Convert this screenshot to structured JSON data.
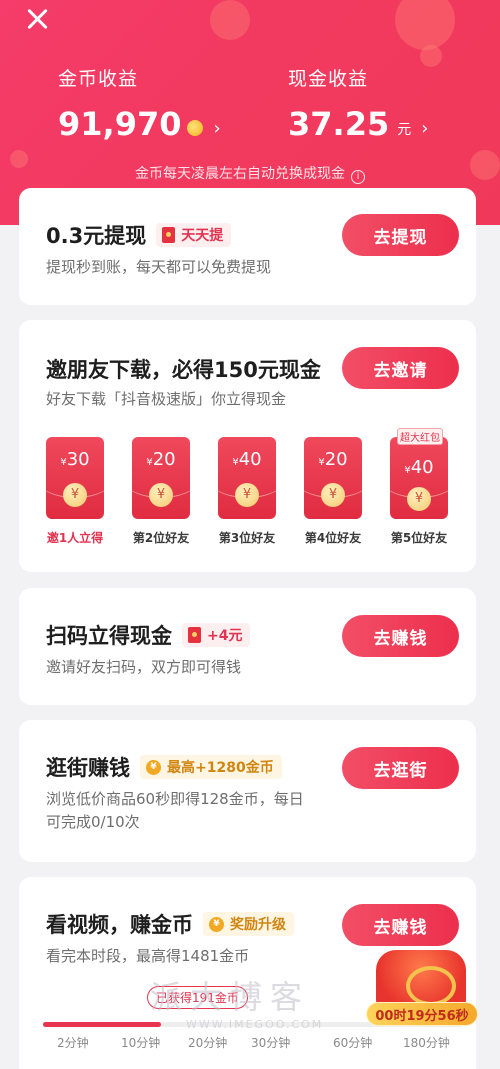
{
  "header": {
    "coin_earnings_label": "金币收益",
    "coin_earnings_value": "91,970",
    "cash_earnings_label": "现金收益",
    "cash_earnings_value": "37.25",
    "cash_unit": "元",
    "chevron": "›",
    "note": "金币每天凌晨左右自动兑换成现金",
    "accent_color": "#f23b61"
  },
  "withdraw_card": {
    "title": "0.3元提现",
    "tag": "天天提",
    "subtitle": "提现秒到账，每天都可以免费提现",
    "button": "去提现"
  },
  "invite_card": {
    "title": "邀朋友下载，必得150元现金",
    "subtitle": "好友下载「抖音极速版」你立得现金",
    "button": "去邀请",
    "packets": [
      {
        "amount": "30",
        "currency": "¥",
        "coin": "¥",
        "label": "邀1人立得",
        "badge": ""
      },
      {
        "amount": "20",
        "currency": "¥",
        "coin": "¥",
        "label": "第2位好友",
        "badge": ""
      },
      {
        "amount": "40",
        "currency": "¥",
        "coin": "¥",
        "label": "第3位好友",
        "badge": ""
      },
      {
        "amount": "20",
        "currency": "¥",
        "coin": "¥",
        "label": "第4位好友",
        "badge": ""
      },
      {
        "amount": "40",
        "currency": "¥",
        "coin": "¥",
        "label": "第5位好友",
        "badge": "超大红包"
      }
    ]
  },
  "scan_card": {
    "title": "扫码立得现金",
    "tag": "+4元",
    "subtitle": "邀请好友扫码，双方即可得钱",
    "button": "去赚钱"
  },
  "shop_card": {
    "title": "逛街赚钱",
    "tag": "最高+1280金币",
    "subtitle_line1": "浏览低价商品60秒即得128金币，每日",
    "subtitle_line2": "可完成0/10次",
    "button": "去逛街"
  },
  "video_card": {
    "title": "看视频，赚金币",
    "tag": "奖励升级",
    "subtitle": "看完本时段，最高得1481金币",
    "button": "去赚钱",
    "progress_tip": "已获得191金币",
    "progress_fraction": 0.28,
    "ticks": [
      "2分钟",
      "10分钟",
      "20分钟",
      "30分钟",
      "60分钟",
      "180分钟"
    ]
  },
  "treasure": {
    "timer": "00时19分56秒"
  },
  "watermark": {
    "text": "派大博客",
    "url": "WWW.IMEGOO.COM"
  }
}
